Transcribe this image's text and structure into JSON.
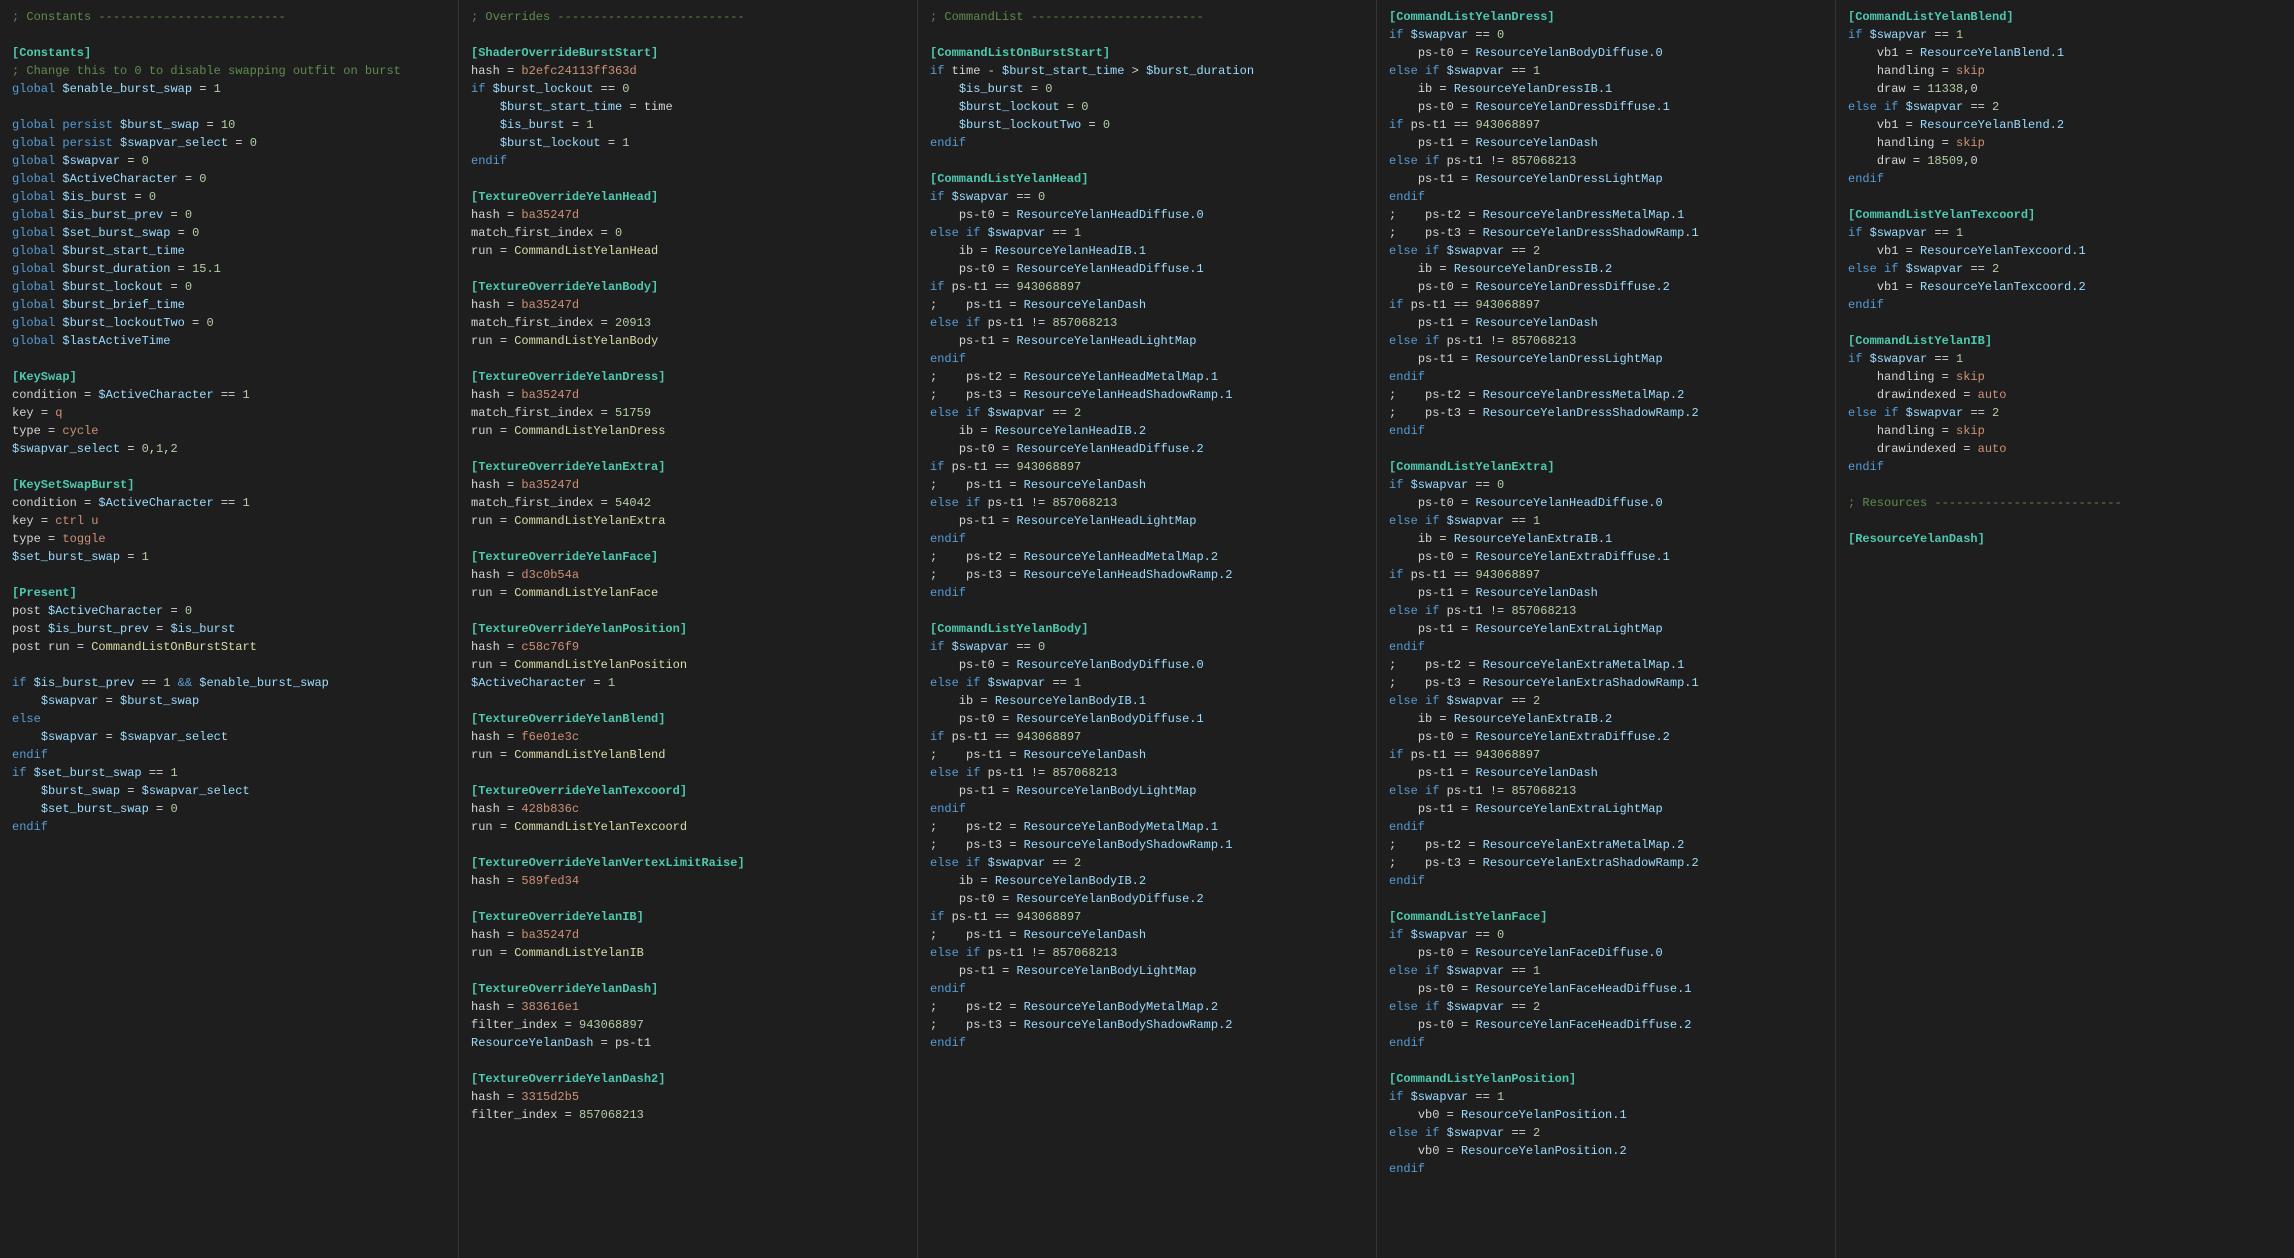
{
  "columns": [
    {
      "id": "col1",
      "content": "constants_and_keys"
    },
    {
      "id": "col2",
      "content": "overrides"
    },
    {
      "id": "col3",
      "content": "commandlist_main"
    },
    {
      "id": "col4",
      "content": "commandlist_dress_extra"
    },
    {
      "id": "col5",
      "content": "commandlist_blend_etc"
    }
  ]
}
